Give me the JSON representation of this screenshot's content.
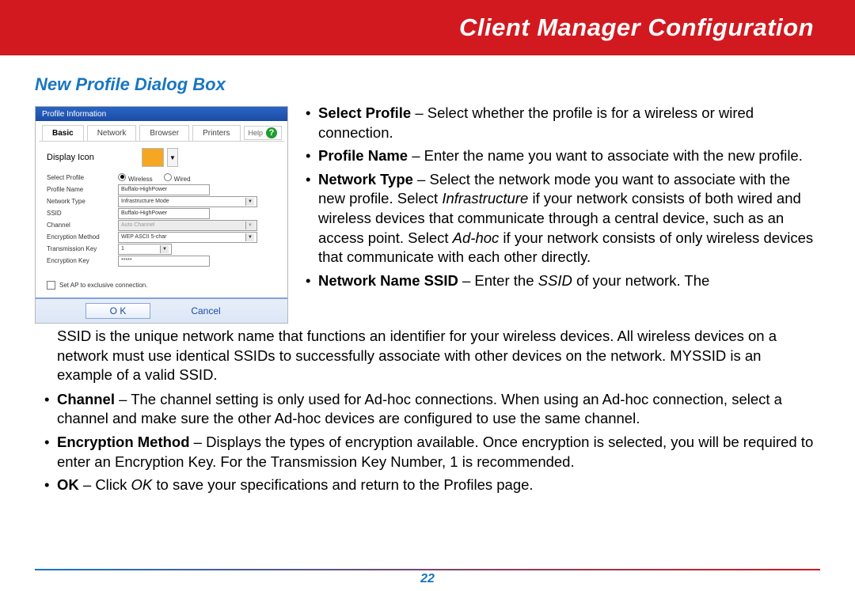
{
  "banner": {
    "title": "Client Manager Configuration"
  },
  "section_title": "New Profile Dialog Box",
  "dialog": {
    "titlebar": "Profile Information",
    "tabs": [
      "Basic",
      "Network",
      "Browser",
      "Printers"
    ],
    "help_label": "Help",
    "display_icon_label": "Display Icon",
    "icon_pick_caret": "▼",
    "rows": {
      "select_profile": {
        "label": "Select Profile",
        "opt_wireless": "Wireless",
        "opt_wired": "Wired"
      },
      "profile_name": {
        "label": "Profile Name",
        "value": "Buffalo-HighPower"
      },
      "network_type": {
        "label": "Network Type",
        "value": "Infrastructure Mode"
      },
      "ssid": {
        "label": "SSID",
        "value": "Buffalo-HighPower"
      },
      "channel": {
        "label": "Channel",
        "value": "Auto Channel"
      },
      "enc_method": {
        "label": "Encryption Method",
        "value": "WEP ASCII 5-char"
      },
      "trans_key": {
        "label": "Transmission Key",
        "value": "1"
      },
      "enc_key": {
        "label": "Encryption Key",
        "value": "*****"
      }
    },
    "checkbox_label": "Set AP to exclusive connection.",
    "btn_ok": "O K",
    "btn_cancel": "Cancel"
  },
  "descriptions": {
    "select_profile": {
      "label": "Select Profile",
      "text": " – Select whether the profile is for a wireless or wired connection."
    },
    "profile_name": {
      "label": "Profile Name",
      "text": " – Enter the name you want to associate with the new profile."
    },
    "network_type": {
      "label": "Network Type",
      "text_a": " – Select the network mode you want to associate with the new profile. Select ",
      "infra": "Infrastructure",
      "text_b": " if your network consists of both wired and wireless devices that communicate through a central device, such as an access point. Select ",
      "adhoc": "Ad-hoc",
      "text_c": " if your network consists of only wireless devices that communicate with each other directly."
    },
    "ssid": {
      "label": "Network Name SSID",
      "text_a": " – Enter the ",
      "ssid_it": "SSID",
      "text_b": " of your network. The "
    },
    "ssid_continuation": "SSID is the unique network name that functions an identifier for your wireless devices. All wireless devices on a network      must use identical SSIDs to successfully associate with other devices on the network. MYSSID is an example of a valid SSID.",
    "channel": {
      "label": "Channel",
      "text": " – The channel setting is only used for Ad-hoc connections.  When using an Ad-hoc connection, select a channel and make sure the other Ad-hoc devices are configured to use the same channel."
    },
    "encryption": {
      "label": "Encryption Method",
      "text": " –  Displays the types of encryption available.  Once encryption is selected, you will be required to enter an Encryption Key.  For the Transmission Key Number, 1 is recommended."
    },
    "ok": {
      "label": "OK",
      "text_a": " – Click ",
      "ok_it": "OK",
      "text_b": " to save your specifications and return to the Profiles page."
    }
  },
  "page_number": "22"
}
